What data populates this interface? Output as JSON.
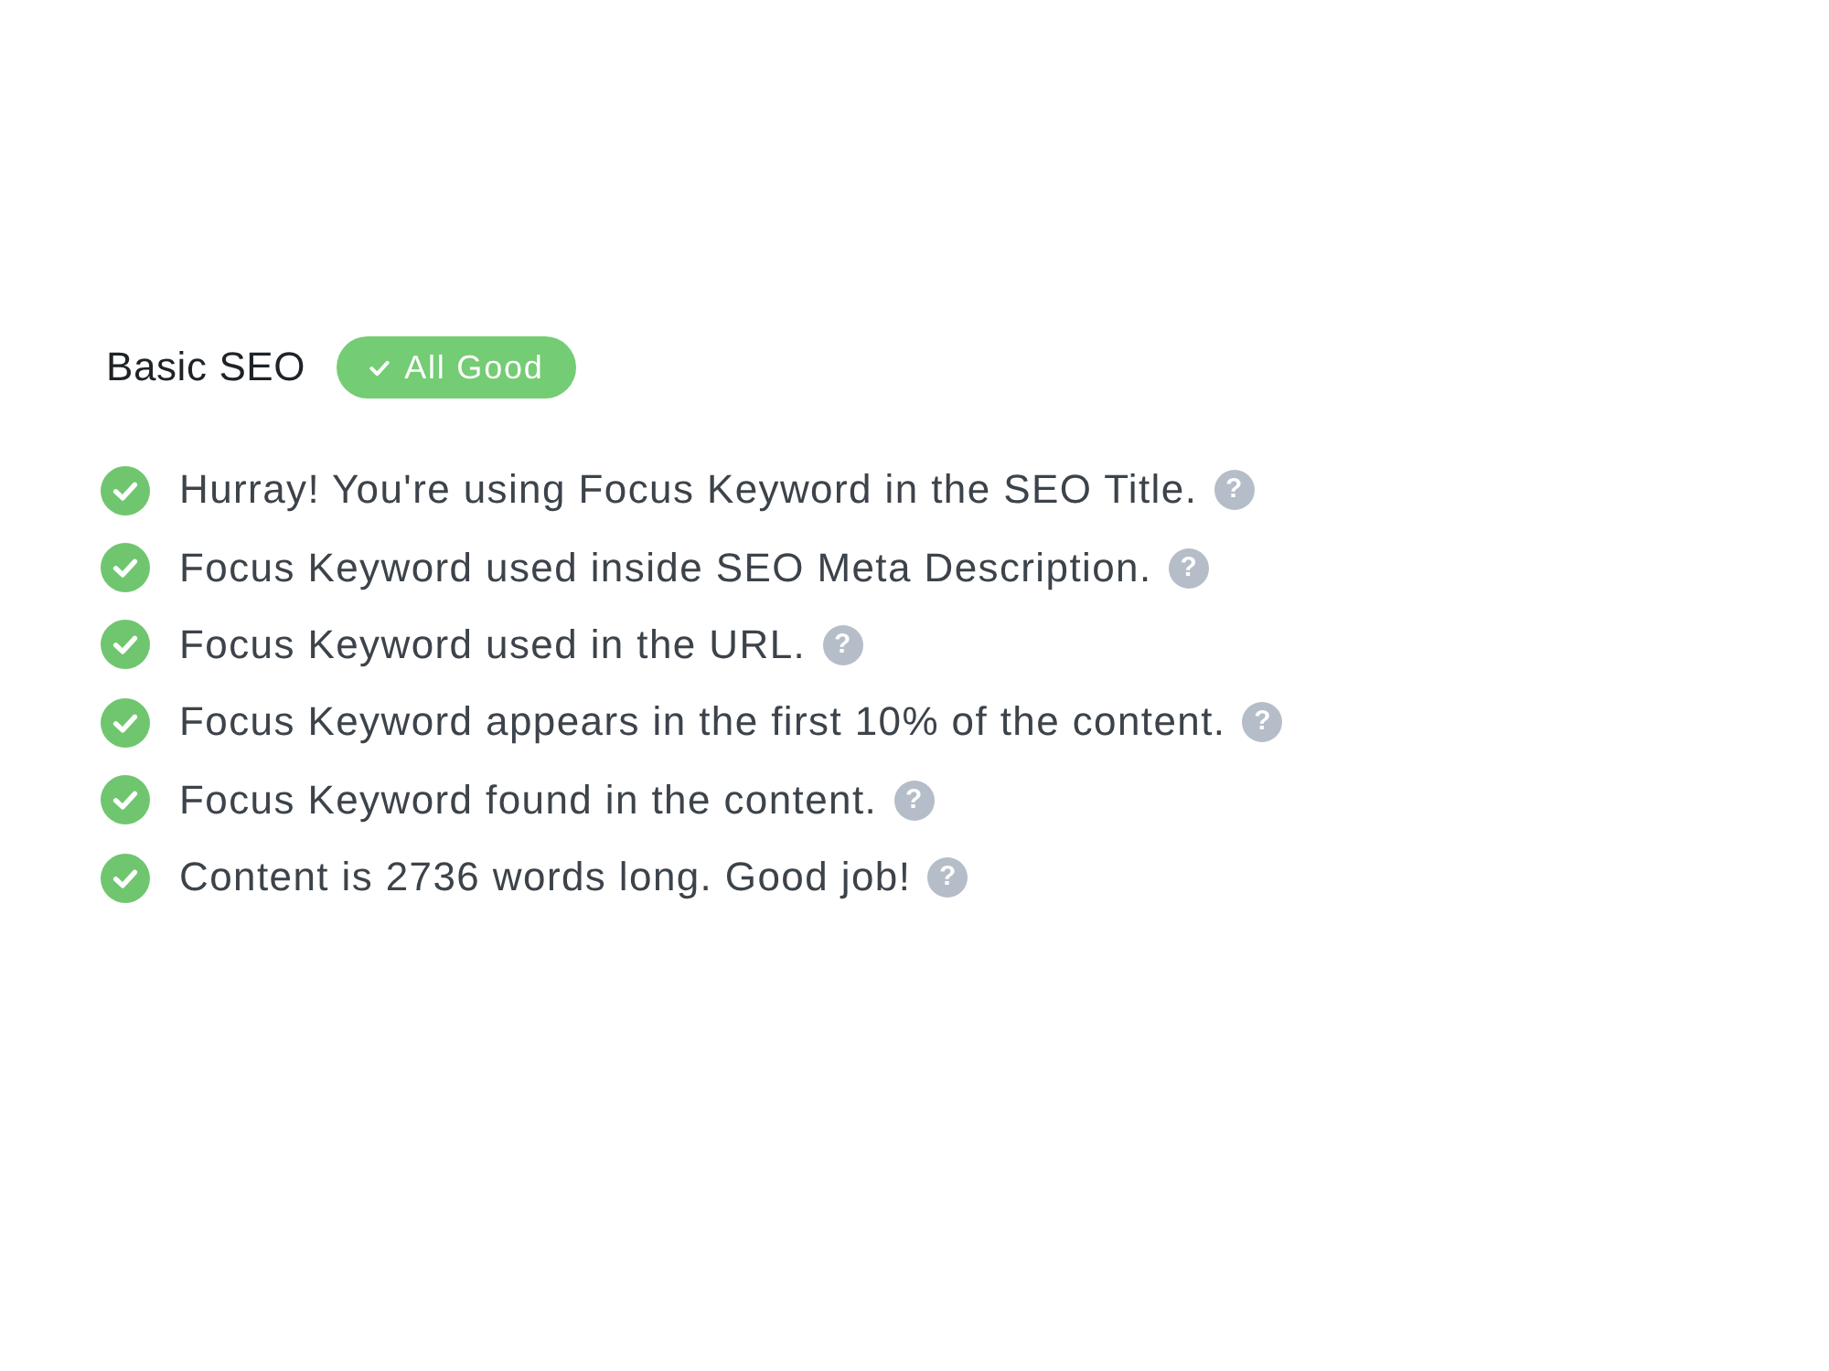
{
  "section": {
    "title": "Basic SEO",
    "badge": {
      "label": "All Good",
      "kind": "good"
    }
  },
  "checks": [
    {
      "text": "Hurray! You're using Focus Keyword in the SEO Title.",
      "passed": true,
      "help": "?"
    },
    {
      "text": "Focus Keyword used inside SEO Meta Description.",
      "passed": true,
      "help": "?"
    },
    {
      "text": "Focus Keyword used in the URL.",
      "passed": true,
      "help": "?"
    },
    {
      "text": "Focus Keyword appears in the first 10% of the content.",
      "passed": true,
      "help": "?"
    },
    {
      "text": "Focus Keyword found in the content.",
      "passed": true,
      "help": "?"
    },
    {
      "text": "Content is 2736 words long. Good job!",
      "passed": true,
      "help": "?"
    }
  ]
}
